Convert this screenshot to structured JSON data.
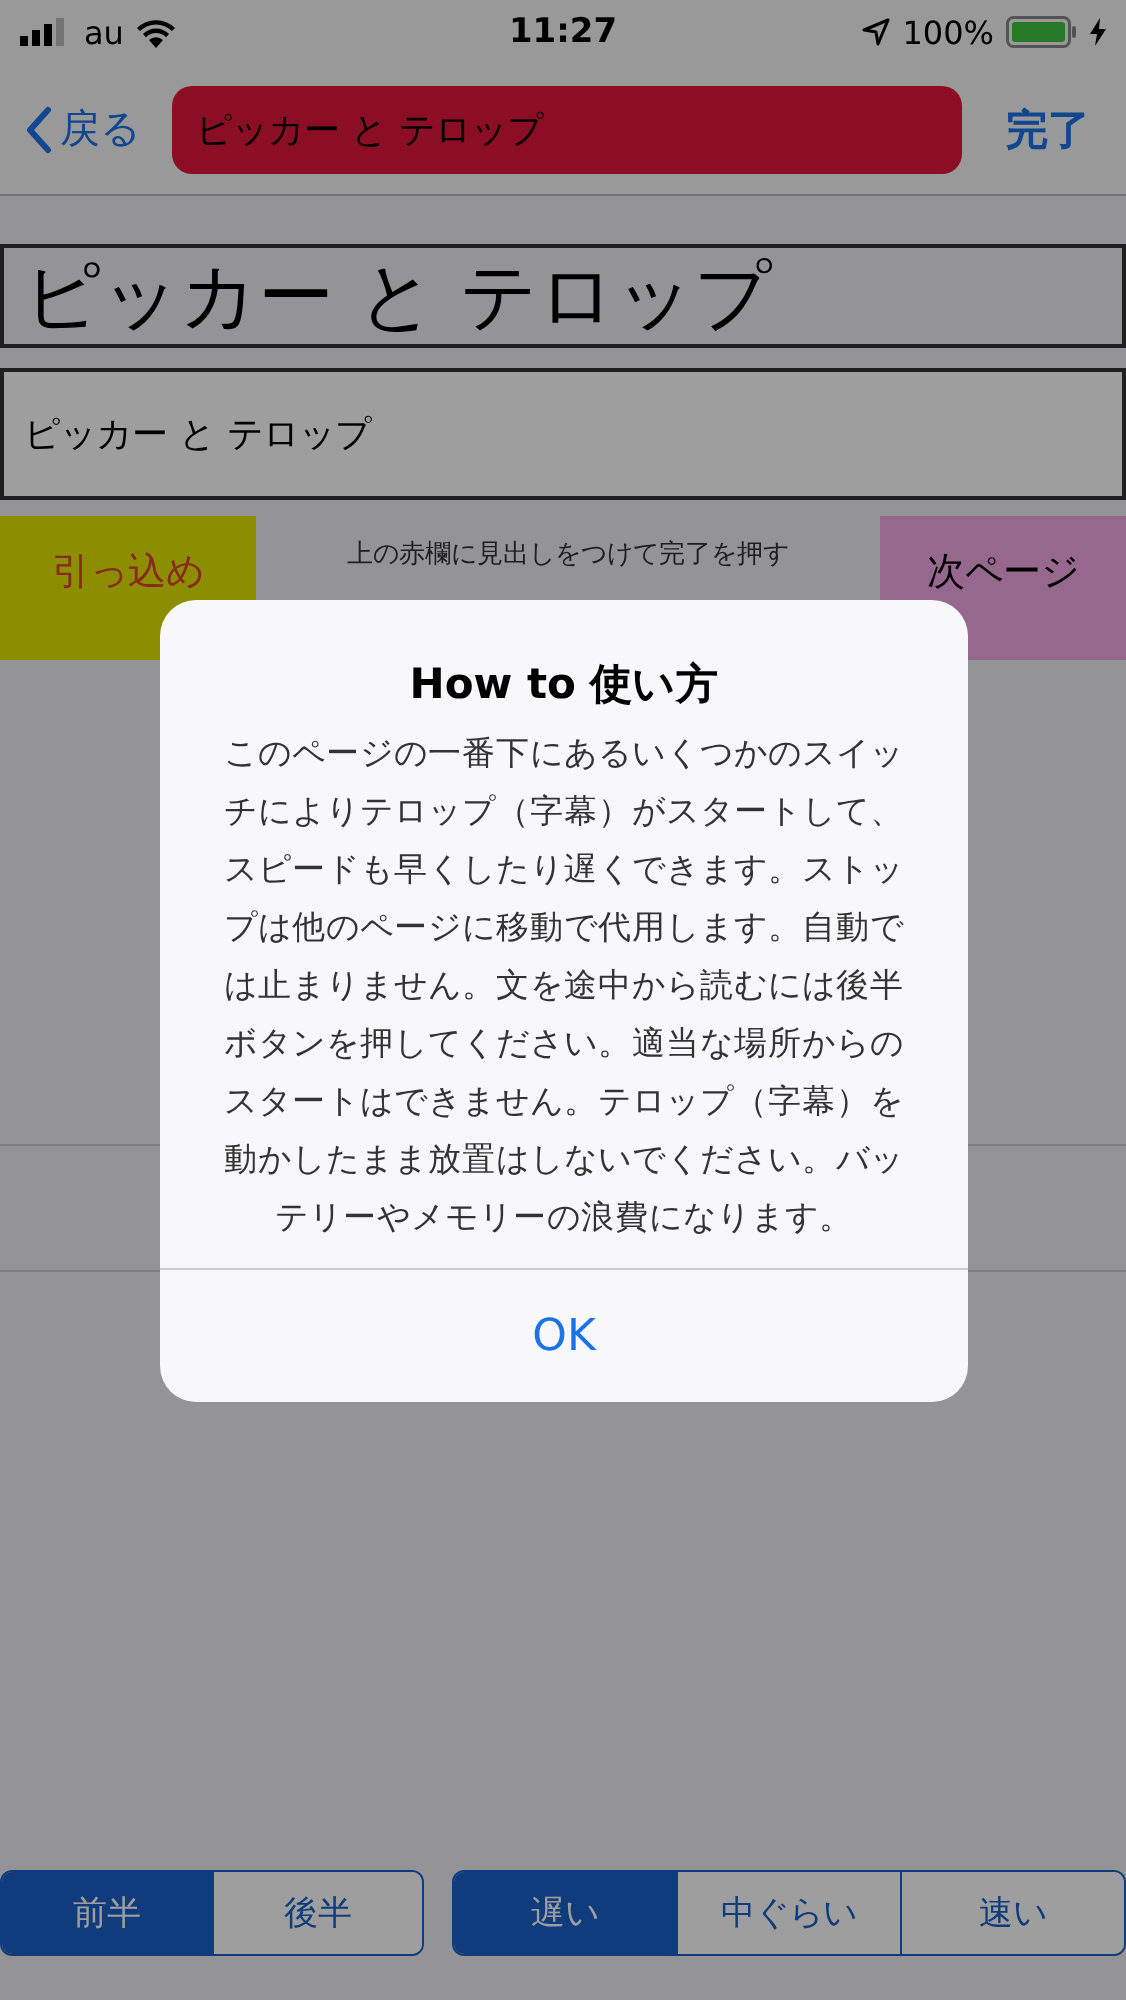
{
  "status_bar": {
    "carrier": "au",
    "time": "11:27",
    "battery": "100%"
  },
  "nav": {
    "back": "戻る",
    "title_field": "ピッカー と テロップ",
    "done": "完了"
  },
  "heading": "ピッカー と テロップ",
  "text_field": "ピッカー と テロップ",
  "actions": {
    "left": "引っ込め",
    "hint": "上の赤欄に見出しをつけて完了を押す",
    "right": "次ページ"
  },
  "part_segments": [
    {
      "label": "前半",
      "selected": true
    },
    {
      "label": "後半",
      "selected": false
    }
  ],
  "speed_segments": [
    {
      "label": "遅い",
      "selected": true
    },
    {
      "label": "中ぐらい",
      "selected": false
    },
    {
      "label": "速い",
      "selected": false
    }
  ],
  "alert": {
    "title": "How to 使い方",
    "message": "このページの一番下にあるいくつかのスイッチによりテロップ（字幕）がスタートして、スピードも早くしたり遅くできます。ストップは他のページに移動で代用します。自動では止まりません。文を途中から読むには後半ボタンを押してください。適当な場所からのスタートはできません。テロップ（字幕）を動かしたまま放置はしないでください。バッテリーやメモリーの浪費になります。",
    "button": "OK"
  }
}
